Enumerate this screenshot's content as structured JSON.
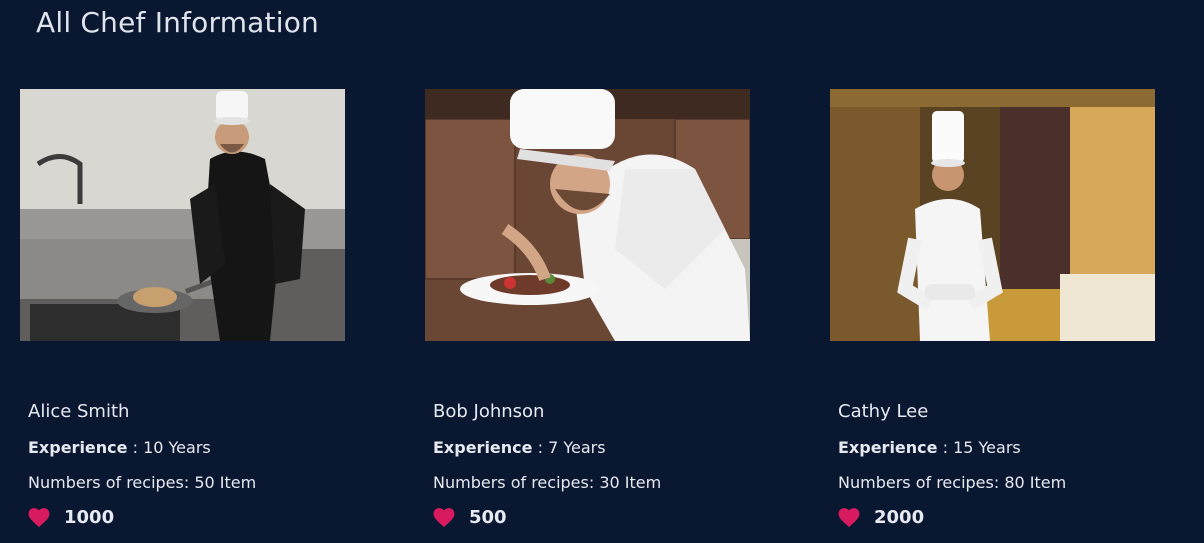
{
  "page": {
    "title": "All Chef Information"
  },
  "labels": {
    "experience": "Experience",
    "experience_sep": " : ",
    "recipes_prefix": "Numbers of recipes: "
  },
  "chefs": [
    {
      "name": "Alice Smith",
      "experience": "10 Years",
      "recipes": "50 Item",
      "likes": "1000"
    },
    {
      "name": "Bob Johnson",
      "experience": "7 Years",
      "recipes": "30 Item",
      "likes": "500"
    },
    {
      "name": "Cathy Lee",
      "experience": "15 Years",
      "recipes": "80 Item",
      "likes": "2000"
    }
  ],
  "colors": {
    "background": "#0a1731",
    "heart": "#d81b60",
    "text": "#e6e9f0"
  },
  "icons": {
    "like": "heart-icon"
  }
}
